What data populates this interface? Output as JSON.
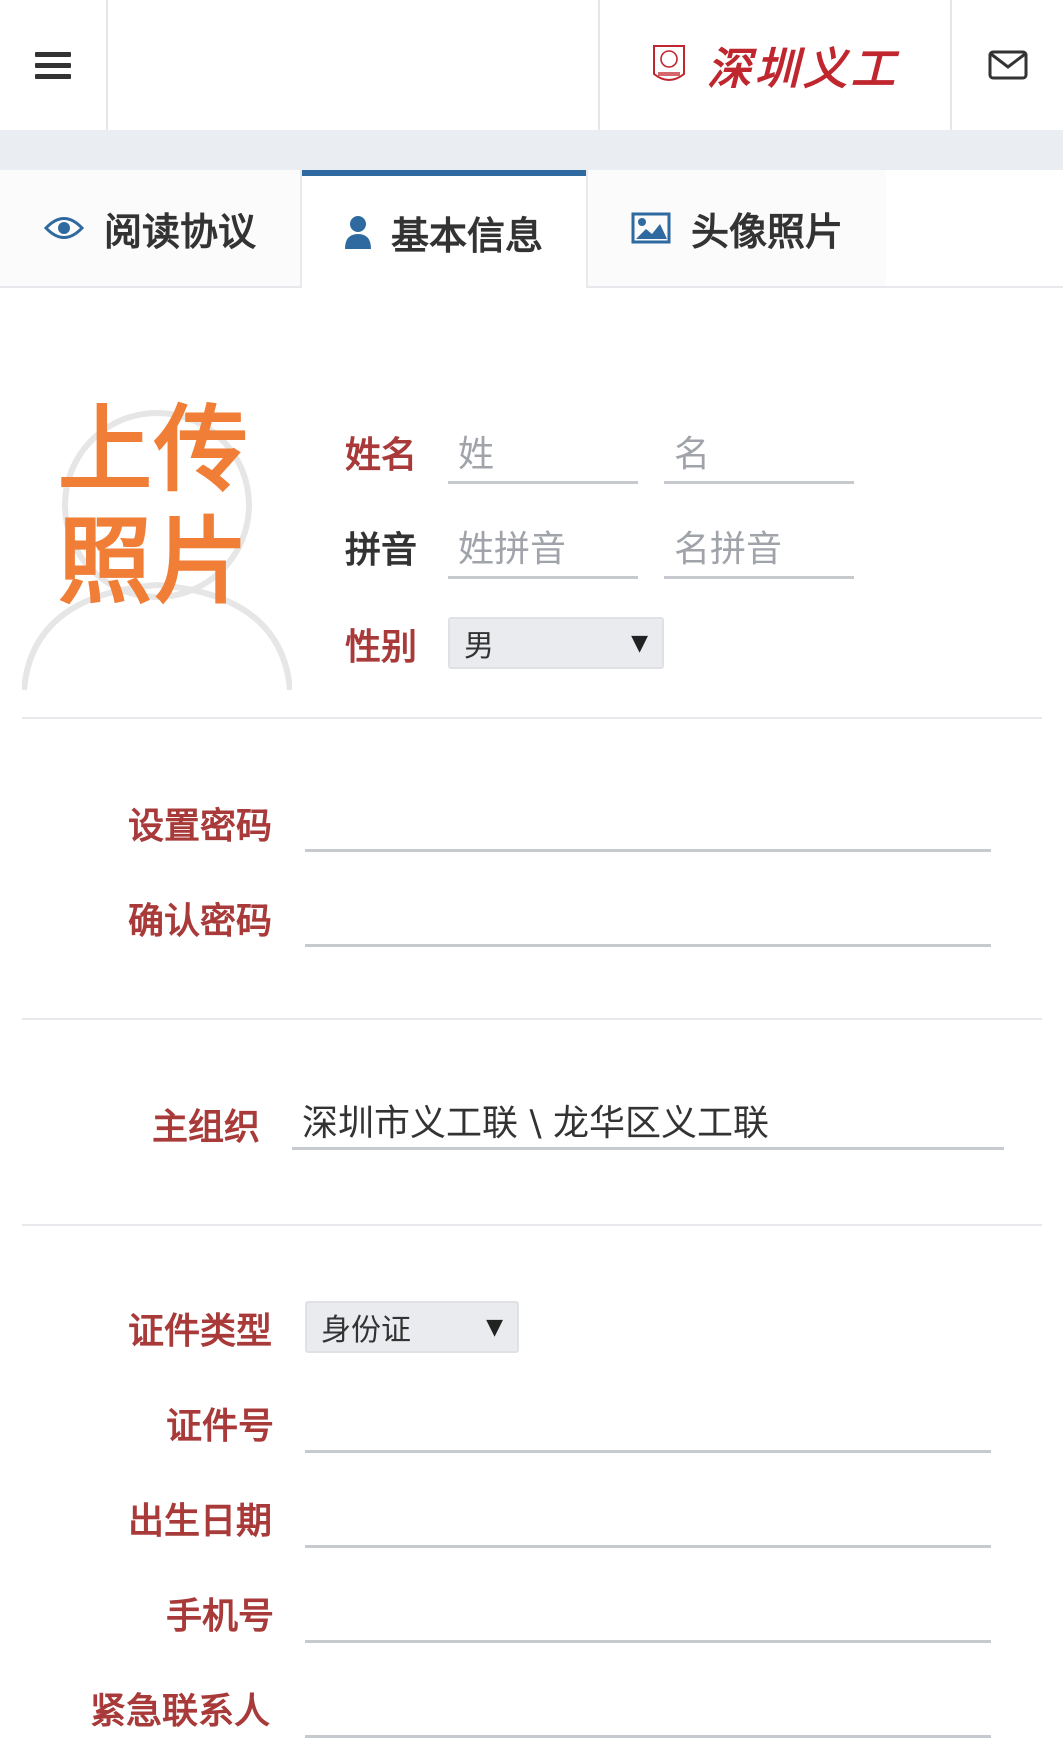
{
  "header": {
    "brand_text": "深圳义工",
    "menu_icon": "hamburger-menu-icon",
    "mail_icon": "envelope-icon",
    "brand_color": "#c0262e"
  },
  "tabs": [
    {
      "label": "阅读协议",
      "icon": "eye-icon",
      "active": false
    },
    {
      "label": "基本信息",
      "icon": "user-icon",
      "active": true
    },
    {
      "label": "头像照片",
      "icon": "image-icon",
      "active": false
    }
  ],
  "photo": {
    "line1": "上传",
    "line2": "照片"
  },
  "name": {
    "label": "姓名",
    "surname_placeholder": "姓",
    "given_placeholder": "名"
  },
  "pinyin": {
    "label": "拼音",
    "surname_placeholder": "姓拼音",
    "given_placeholder": "名拼音"
  },
  "gender": {
    "label": "性别",
    "value": "男"
  },
  "password": {
    "set_label": "设置密码",
    "confirm_label": "确认密码"
  },
  "org": {
    "label": "主组织",
    "value": "深圳市义工联 \\ 龙华区义工联"
  },
  "id": {
    "type_label": "证件类型",
    "type_value": "身份证",
    "number_label": "证件号"
  },
  "birth_label": "出生日期",
  "phone_label": "手机号",
  "emergency_label": "紧急联系人",
  "colors": {
    "label_red": "#a83a3a",
    "active_tab": "#2e6aa0",
    "photo_orange": "#f07e36"
  }
}
